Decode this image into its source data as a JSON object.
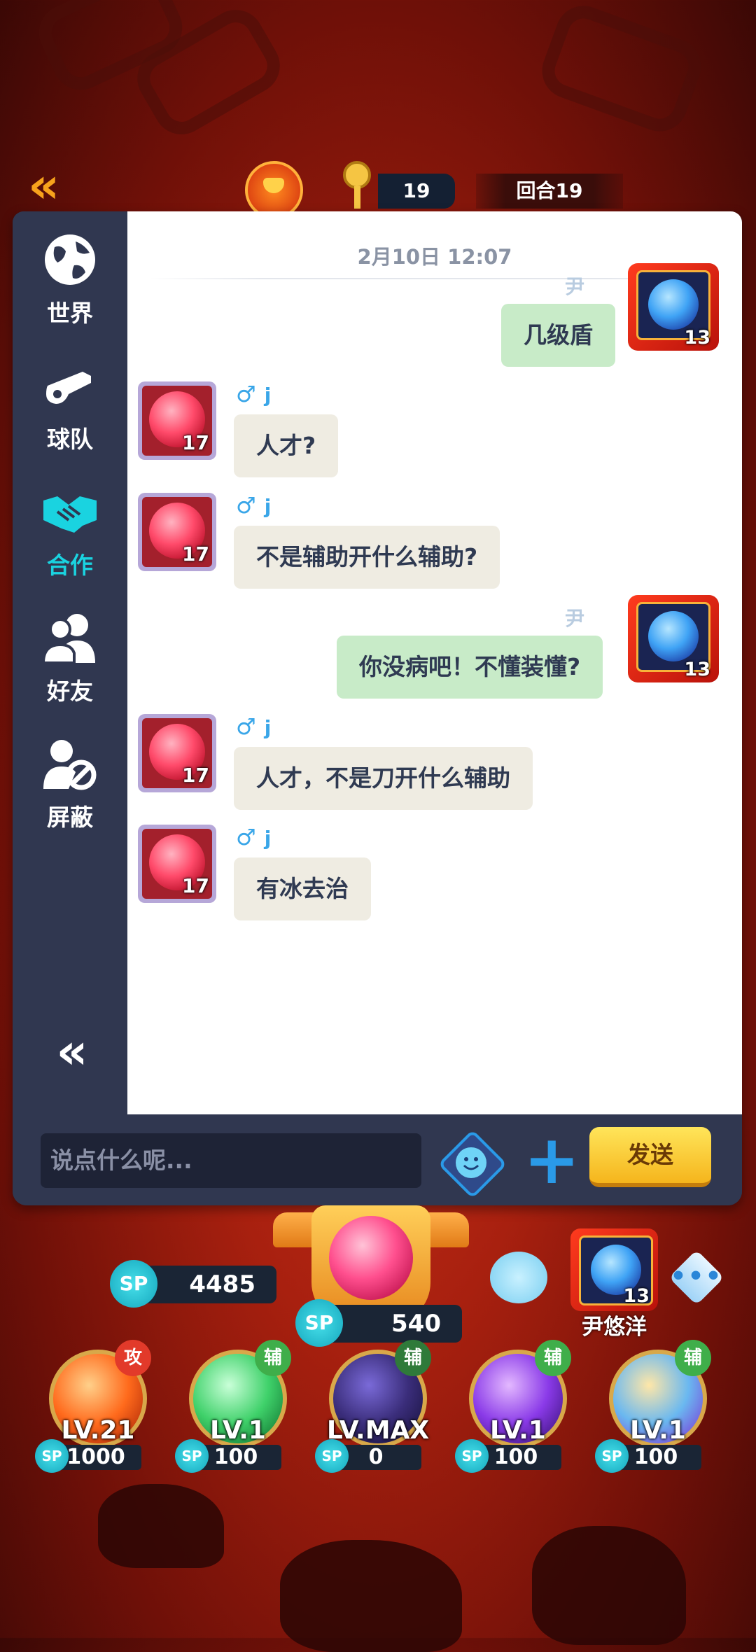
{
  "hud": {
    "back_icon": "double-chevron-left-icon",
    "back_text": "«",
    "key_count": "19",
    "round_label": "回合19"
  },
  "sidebar": {
    "items": [
      {
        "label": "世界",
        "icon": "globe-icon"
      },
      {
        "label": "球队",
        "icon": "whistle-icon"
      },
      {
        "label": "合作",
        "icon": "handshake-icon",
        "active": true
      },
      {
        "label": "好友",
        "icon": "friends-icon"
      },
      {
        "label": "屏蔽",
        "icon": "block-user-icon"
      }
    ],
    "collapse_text": "«"
  },
  "chat": {
    "date_stamp": "2月10日 12:07",
    "messages": [
      {
        "side": "right",
        "sender": "尹悠洋",
        "text": "几级盾",
        "level": "13"
      },
      {
        "side": "left",
        "gender": "♂",
        "sender": "j",
        "text": "人才?",
        "level": "17"
      },
      {
        "side": "left",
        "gender": "♂",
        "sender": "j",
        "text": "不是辅助开什么辅助?",
        "level": "17"
      },
      {
        "side": "right",
        "sender": "尹悠洋",
        "text": "你没病吧！不懂装懂?",
        "level": "13"
      },
      {
        "side": "left",
        "gender": "♂",
        "sender": "j",
        "text": "人才，不是刀开什么辅助",
        "level": "17"
      },
      {
        "side": "left",
        "gender": "♂",
        "sender": "j",
        "text": "有冰去治",
        "level": "17"
      }
    ]
  },
  "input": {
    "placeholder": "说点什么呢...",
    "send_label": "发送",
    "plus_label": "+"
  },
  "game": {
    "sp_total": "4485",
    "sp_current": "540",
    "sp_label": "SP",
    "self_name": "尹悠洋",
    "self_level": "13",
    "more_dots": "•••",
    "skills": [
      {
        "tag": "攻",
        "level": "LV.21",
        "cost": "1000",
        "color": "#ff6a1c",
        "tag_color": "#e23a2a"
      },
      {
        "tag": "辅",
        "level": "LV.1",
        "cost": "100",
        "color": "#3fd16a",
        "tag_color": "#3fae4a"
      },
      {
        "tag": "辅",
        "level": "LV.MAX",
        "cost": "0",
        "color": "#3a2d7a",
        "tag_color": "#3fae4a"
      },
      {
        "tag": "辅",
        "level": "LV.1",
        "cost": "100",
        "color": "#8a3ae8",
        "tag_color": "#3fae4a"
      },
      {
        "tag": "辅",
        "level": "LV.1",
        "cost": "100",
        "color": "#6ab8f0",
        "tag_color": "#3fae4a"
      }
    ]
  }
}
